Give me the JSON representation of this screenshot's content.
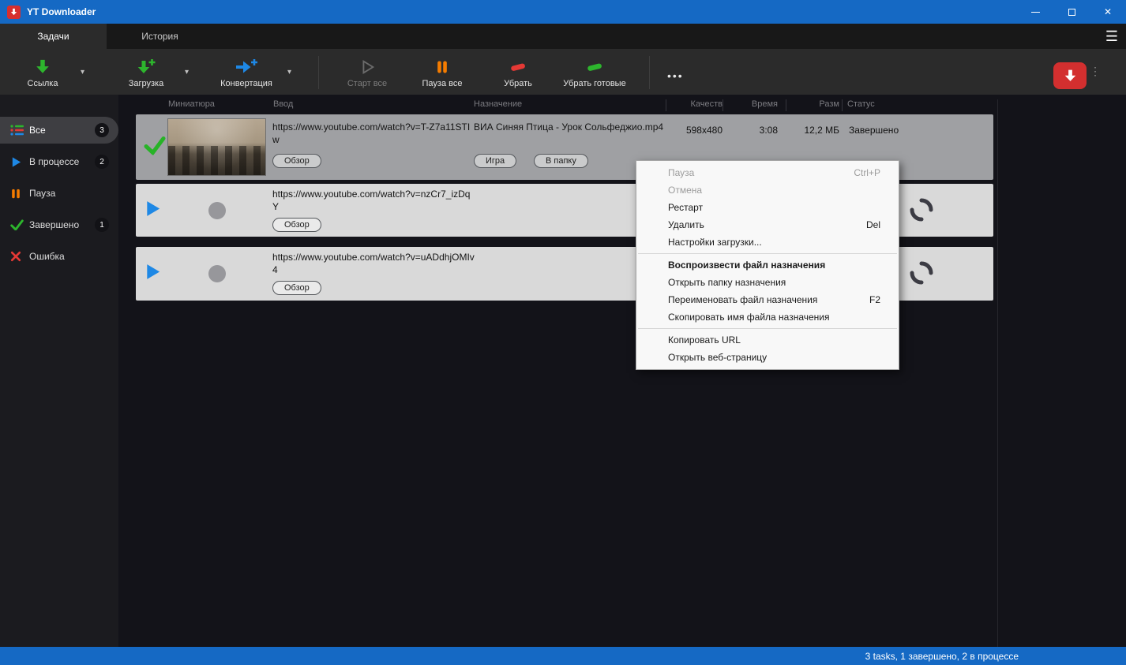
{
  "window": {
    "title": "YT Downloader",
    "status_bar": "3 tasks, 1 завершено, 2 в процессе"
  },
  "icons": {
    "chevron_down": "▾",
    "hamburger": "☰",
    "kebab": "⋮",
    "close": "✕"
  },
  "tabs": {
    "tasks": "Задачи",
    "history": "История"
  },
  "toolbar": {
    "link": "Ссылка",
    "download": "Загрузка",
    "convert": "Конвертация",
    "start_all": "Старт все",
    "pause_all": "Пауза все",
    "remove": "Убрать",
    "remove_done": "Убрать готовые",
    "more": "•••"
  },
  "sidebar": {
    "items": [
      {
        "label": "Все",
        "badge": "3"
      },
      {
        "label": "В процессе",
        "badge": "2"
      },
      {
        "label": "Пауза",
        "badge": ""
      },
      {
        "label": "Завершено",
        "badge": "1"
      },
      {
        "label": "Ошибка",
        "badge": ""
      }
    ]
  },
  "table": {
    "headers": {
      "thumbnail": "Миниатюра",
      "input": "Ввод",
      "destination": "Назначение",
      "quality": "Качеств",
      "time": "Время",
      "size": "Разм",
      "status": "Статус"
    },
    "rows": [
      {
        "url": "https://www.youtube.com/watch?v=T-Z7a11STIw",
        "browse": "Обзор",
        "destination": "ВИА Синяя Птица - Урок Сольфеджио.mp4",
        "play": "Игра",
        "folder": "В папку",
        "quality": "598x480",
        "time": "3:08",
        "size": "12,2 МБ",
        "status": "Завершено"
      },
      {
        "url": "https://www.youtube.com/watch?v=nzCr7_izDqY",
        "browse": "Обзор"
      },
      {
        "url": "https://www.youtube.com/watch?v=uADdhjOMIv4",
        "browse": "Обзор"
      }
    ]
  },
  "context_menu": {
    "items": [
      {
        "label": "Пауза",
        "shortcut": "Ctrl+P"
      },
      {
        "label": "Отмена"
      },
      {
        "label": "Рестарт"
      },
      {
        "label": "Удалить",
        "shortcut": "Del"
      },
      {
        "label": "Настройки загрузки..."
      },
      {
        "label": "Воспроизвести файл назначения"
      },
      {
        "label": "Открыть папку назначения"
      },
      {
        "label": "Переименовать файл назначения",
        "shortcut": "F2"
      },
      {
        "label": "Скопировать имя файла назначения"
      },
      {
        "label": "Копировать URL"
      },
      {
        "label": "Открыть веб-страницу"
      }
    ]
  },
  "colors": {
    "accent_blue": "#1569c4",
    "success_green": "#2db52d",
    "pause_orange": "#f57c00",
    "error_red": "#e53935",
    "convert_blue": "#1e88e5"
  }
}
